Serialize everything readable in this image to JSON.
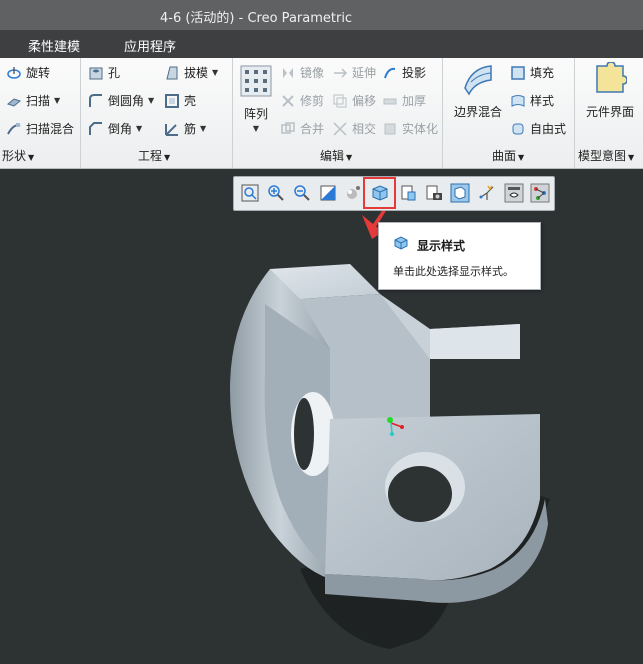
{
  "window": {
    "title": "4-6 (活动的) - Creo Parametric"
  },
  "menu": {
    "tabs": [
      "柔性建模",
      "应用程序"
    ]
  },
  "ribbon": {
    "shape_group": {
      "label": "形状",
      "items": [
        "旋转",
        "扫描",
        "扫描混合"
      ]
    },
    "engineering_group": {
      "label": "工程",
      "left": [
        "孔",
        "倒圆角",
        "倒角"
      ],
      "right": [
        "拔模",
        "壳",
        "筋"
      ]
    },
    "edit_group": {
      "label": "编辑",
      "pattern": "阵列",
      "col1": [
        "镜像",
        "修剪",
        "合并"
      ],
      "col2": [
        "延伸",
        "偏移",
        "相交"
      ],
      "col3": [
        "投影",
        "加厚",
        "实体化"
      ]
    },
    "surface_group": {
      "label": "曲面",
      "boundary": "边界混合",
      "items": [
        "填充",
        "样式",
        "自由式"
      ]
    },
    "model_intent_group": {
      "label": "模型意图",
      "component_interface": "元件界面"
    }
  },
  "tooltip": {
    "title": "显示样式",
    "description": "单击此处选择显示样式。"
  },
  "colors": {
    "accent_red": "#e53a3a",
    "model": "#b9c4cc",
    "viewport": "#2d3233"
  }
}
